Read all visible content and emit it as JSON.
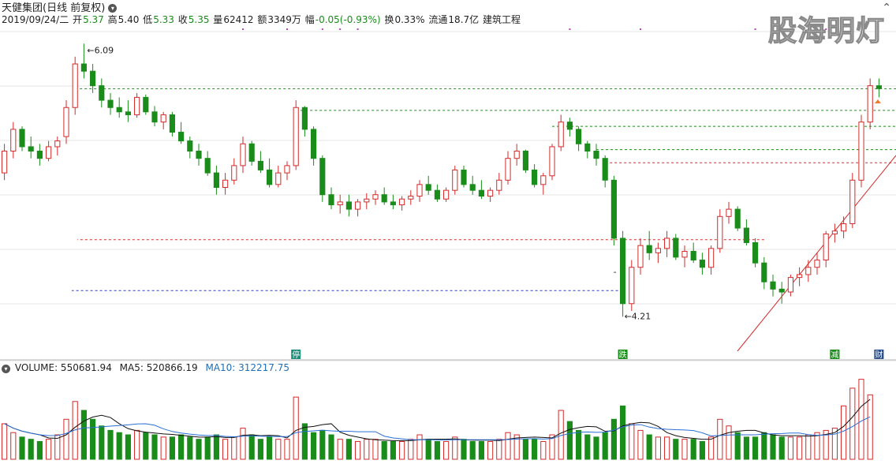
{
  "header": {
    "title": "天健集团(日线 前复权)",
    "date": "2019/09/24/二",
    "open_label": "开",
    "open": "5.37",
    "high_label": "高",
    "high": "5.40",
    "low_label": "低",
    "low": "5.33",
    "close_label": "收",
    "close": "5.35",
    "vol_label": "量",
    "volume": "62412",
    "amt_label": "额",
    "amount": "3349万",
    "chg_label": "幅",
    "change": "-0.05(-0.93%)",
    "turn_label": "换",
    "turnover": "0.33%",
    "float_label": "流通",
    "float_cap": "18.7亿",
    "industry": "建筑工程"
  },
  "watermark": "股海明灯",
  "annotations": {
    "max": "6.09",
    "min": "4.21",
    "min_marker": "-"
  },
  "flags": [
    "停",
    "跌",
    "减",
    "财"
  ],
  "volume_panel": {
    "label": "VOLUME: 550681.94",
    "ma5": "MA5: 520866.19",
    "ma10": "MA10: 312217.75"
  },
  "colors": {
    "up": "#d42a2a",
    "down": "#1a8c1a",
    "ma5": "#111111",
    "ma10": "#2a6fd6",
    "trend": "#d42a2a"
  },
  "chart_data": {
    "type": "candlestick",
    "title": "天健集团(日线 前复权)",
    "price_max": 6.09,
    "price_min": 4.21,
    "ylim": [
      4.0,
      6.2
    ],
    "candles": [
      [
        5.2,
        5.4,
        5.15,
        5.35
      ],
      [
        5.35,
        5.55,
        5.3,
        5.5
      ],
      [
        5.5,
        5.52,
        5.35,
        5.38
      ],
      [
        5.38,
        5.45,
        5.3,
        5.35
      ],
      [
        5.35,
        5.4,
        5.25,
        5.3
      ],
      [
        5.3,
        5.42,
        5.28,
        5.38
      ],
      [
        5.38,
        5.45,
        5.32,
        5.42
      ],
      [
        5.45,
        5.7,
        5.4,
        5.65
      ],
      [
        5.65,
        6.0,
        5.6,
        5.95
      ],
      [
        5.95,
        6.09,
        5.85,
        5.9
      ],
      [
        5.9,
        5.95,
        5.75,
        5.8
      ],
      [
        5.8,
        5.85,
        5.65,
        5.7
      ],
      [
        5.7,
        5.75,
        5.6,
        5.65
      ],
      [
        5.65,
        5.72,
        5.58,
        5.62
      ],
      [
        5.62,
        5.7,
        5.55,
        5.6
      ],
      [
        5.6,
        5.75,
        5.58,
        5.72
      ],
      [
        5.72,
        5.74,
        5.6,
        5.62
      ],
      [
        5.62,
        5.66,
        5.52,
        5.55
      ],
      [
        5.55,
        5.62,
        5.5,
        5.6
      ],
      [
        5.6,
        5.62,
        5.45,
        5.48
      ],
      [
        5.48,
        5.55,
        5.4,
        5.42
      ],
      [
        5.42,
        5.45,
        5.3,
        5.35
      ],
      [
        5.35,
        5.4,
        5.25,
        5.3
      ],
      [
        5.3,
        5.35,
        5.18,
        5.2
      ],
      [
        5.2,
        5.25,
        5.05,
        5.1
      ],
      [
        5.1,
        5.2,
        5.05,
        5.15
      ],
      [
        5.15,
        5.3,
        5.12,
        5.25
      ],
      [
        5.25,
        5.45,
        5.2,
        5.4
      ],
      [
        5.4,
        5.42,
        5.25,
        5.28
      ],
      [
        5.28,
        5.35,
        5.2,
        5.22
      ],
      [
        5.22,
        5.3,
        5.1,
        5.12
      ],
      [
        5.12,
        5.25,
        5.1,
        5.2
      ],
      [
        5.2,
        5.28,
        5.15,
        5.25
      ],
      [
        5.25,
        5.7,
        5.22,
        5.65
      ],
      [
        5.65,
        5.66,
        5.45,
        5.5
      ],
      [
        5.5,
        5.52,
        5.25,
        5.3
      ],
      [
        5.3,
        5.32,
        5.0,
        5.05
      ],
      [
        5.05,
        5.1,
        4.95,
        4.98
      ],
      [
        4.98,
        5.05,
        4.92,
        5.0
      ],
      [
        5.0,
        5.05,
        4.9,
        4.95
      ],
      [
        4.95,
        5.02,
        4.9,
        5.0
      ],
      [
        5.0,
        5.06,
        4.95,
        5.02
      ],
      [
        5.02,
        5.08,
        4.98,
        5.05
      ],
      [
        5.05,
        5.1,
        4.98,
        5.0
      ],
      [
        5.0,
        5.05,
        4.95,
        4.98
      ],
      [
        4.98,
        5.04,
        4.94,
        5.02
      ],
      [
        5.02,
        5.08,
        4.98,
        5.04
      ],
      [
        5.04,
        5.15,
        5.0,
        5.12
      ],
      [
        5.12,
        5.18,
        5.05,
        5.08
      ],
      [
        5.08,
        5.12,
        5.0,
        5.02
      ],
      [
        5.02,
        5.1,
        5.0,
        5.08
      ],
      [
        5.08,
        5.25,
        5.05,
        5.22
      ],
      [
        5.22,
        5.25,
        5.1,
        5.12
      ],
      [
        5.12,
        5.18,
        5.05,
        5.08
      ],
      [
        5.08,
        5.15,
        5.02,
        5.04
      ],
      [
        5.04,
        5.1,
        5.0,
        5.08
      ],
      [
        5.08,
        5.2,
        5.05,
        5.15
      ],
      [
        5.15,
        5.35,
        5.12,
        5.3
      ],
      [
        5.3,
        5.4,
        5.25,
        5.35
      ],
      [
        5.35,
        5.36,
        5.2,
        5.22
      ],
      [
        5.22,
        5.26,
        5.1,
        5.12
      ],
      [
        5.12,
        5.2,
        5.05,
        5.18
      ],
      [
        5.18,
        5.4,
        5.15,
        5.38
      ],
      [
        5.38,
        5.6,
        5.35,
        5.55
      ],
      [
        5.55,
        5.58,
        5.45,
        5.5
      ],
      [
        5.5,
        5.52,
        5.35,
        5.4
      ],
      [
        5.4,
        5.42,
        5.3,
        5.35
      ],
      [
        5.35,
        5.4,
        5.25,
        5.3
      ],
      [
        5.3,
        5.32,
        5.1,
        5.15
      ],
      [
        5.15,
        5.18,
        4.7,
        4.75
      ],
      [
        4.75,
        4.8,
        4.21,
        4.3
      ],
      [
        4.3,
        4.6,
        4.25,
        4.55
      ],
      [
        4.55,
        4.75,
        4.5,
        4.7
      ],
      [
        4.7,
        4.8,
        4.6,
        4.65
      ],
      [
        4.65,
        4.72,
        4.58,
        4.68
      ],
      [
        4.68,
        4.8,
        4.62,
        4.75
      ],
      [
        4.75,
        4.78,
        4.6,
        4.62
      ],
      [
        4.62,
        4.7,
        4.55,
        4.66
      ],
      [
        4.66,
        4.72,
        4.58,
        4.6
      ],
      [
        4.6,
        4.65,
        4.5,
        4.55
      ],
      [
        4.55,
        4.7,
        4.5,
        4.68
      ],
      [
        4.68,
        4.95,
        4.65,
        4.9
      ],
      [
        4.9,
        5.0,
        4.85,
        4.95
      ],
      [
        4.95,
        4.97,
        4.8,
        4.82
      ],
      [
        4.82,
        4.88,
        4.7,
        4.72
      ],
      [
        4.72,
        4.75,
        4.55,
        4.58
      ],
      [
        4.58,
        4.62,
        4.4,
        4.45
      ],
      [
        4.45,
        4.5,
        4.35,
        4.4
      ],
      [
        4.4,
        4.45,
        4.3,
        4.38
      ],
      [
        4.38,
        4.5,
        4.35,
        4.48
      ],
      [
        4.48,
        4.55,
        4.42,
        4.5
      ],
      [
        4.5,
        4.6,
        4.45,
        4.55
      ],
      [
        4.55,
        4.65,
        4.5,
        4.6
      ],
      [
        4.6,
        4.8,
        4.55,
        4.78
      ],
      [
        4.78,
        4.85,
        4.72,
        4.8
      ],
      [
        4.8,
        4.9,
        4.75,
        4.85
      ],
      [
        4.85,
        5.2,
        4.82,
        5.15
      ],
      [
        5.15,
        5.6,
        5.1,
        5.55
      ],
      [
        5.55,
        5.85,
        5.5,
        5.8
      ],
      [
        5.8,
        5.85,
        5.72,
        5.78
      ]
    ],
    "volume": {
      "values": [
        1.6,
        1.2,
        1.0,
        0.9,
        0.8,
        0.9,
        1.1,
        1.8,
        2.6,
        2.2,
        1.8,
        1.5,
        1.3,
        1.2,
        1.1,
        1.3,
        1.2,
        1.1,
        1.0,
        1.0,
        1.1,
        1.0,
        0.9,
        1.0,
        1.1,
        0.9,
        1.0,
        1.4,
        1.1,
        0.9,
        1.0,
        0.9,
        0.9,
        2.8,
        1.6,
        1.2,
        1.3,
        1.1,
        0.9,
        0.9,
        0.8,
        0.9,
        0.9,
        0.8,
        0.8,
        0.8,
        0.9,
        1.1,
        0.9,
        0.8,
        0.8,
        1.0,
        0.9,
        0.8,
        0.8,
        0.8,
        0.9,
        1.2,
        1.1,
        0.9,
        0.9,
        0.8,
        1.1,
        2.2,
        1.7,
        1.3,
        1.1,
        1.0,
        1.2,
        1.8,
        2.4,
        1.6,
        1.3,
        1.1,
        1.0,
        1.0,
        0.9,
        0.9,
        0.9,
        0.8,
        1.0,
        1.8,
        1.5,
        1.2,
        1.0,
        1.0,
        1.2,
        1.1,
        1.0,
        1.0,
        1.0,
        1.1,
        1.2,
        1.3,
        1.4,
        2.4,
        3.2,
        3.6,
        2.9
      ],
      "ma5": 520866.19,
      "ma10": 312217.75,
      "current": 550681.94
    }
  }
}
